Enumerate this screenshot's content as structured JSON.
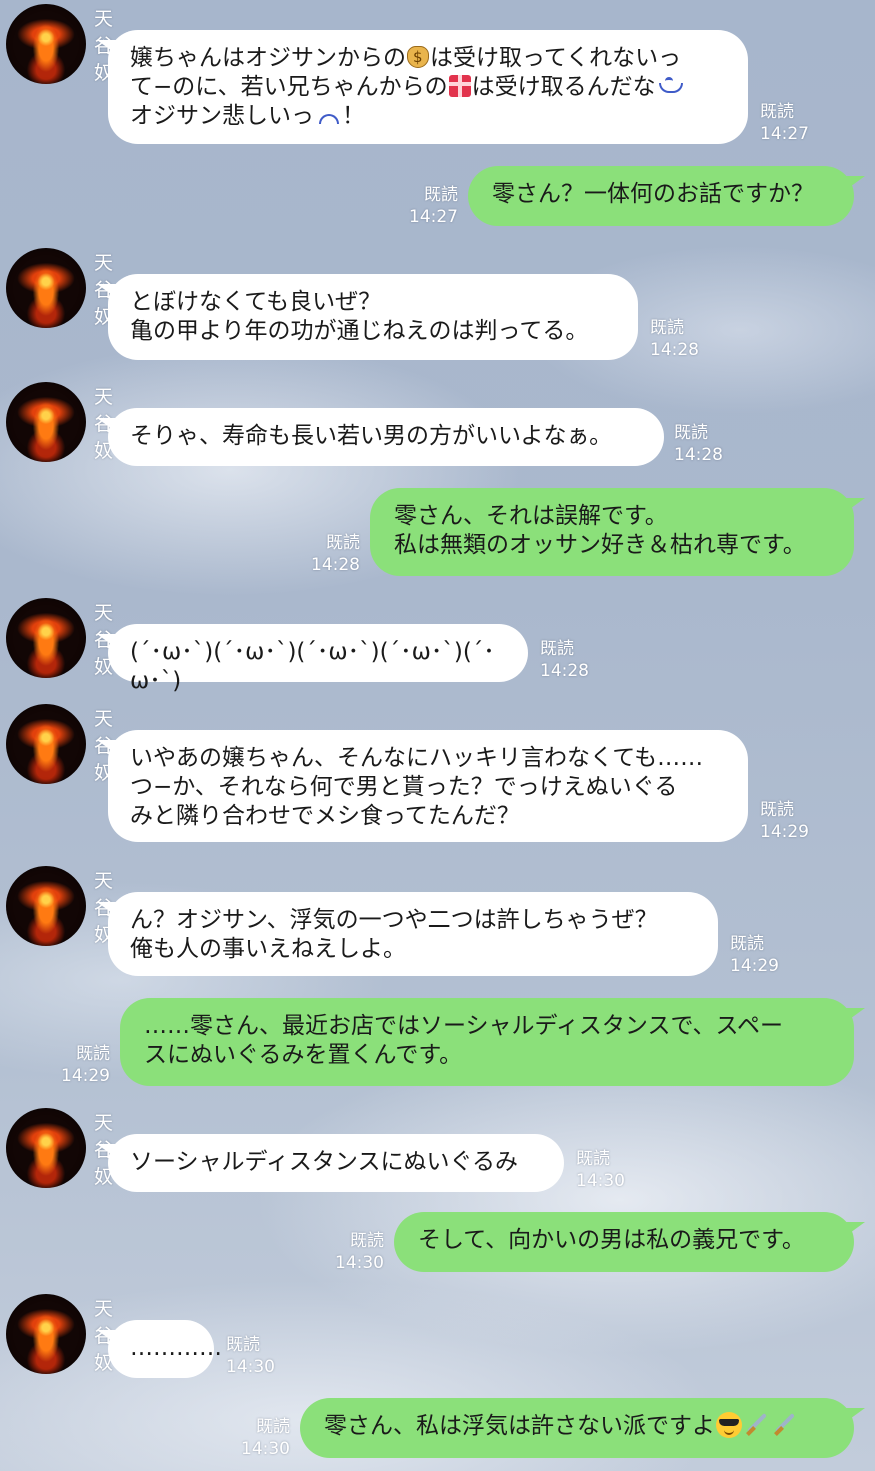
{
  "chat": {
    "sender_name": "天谷奴",
    "read_label": "既読",
    "messages": [
      {
        "side": "in",
        "text": "嬢ちゃんはオジサンからの{money}は受け取ってくれないっ\nて−のに、若い兄ちゃんからの{gift}は受け取るんだな{sweat}\nオジサン悲しいっ{sad}！",
        "time": "14:27"
      },
      {
        "side": "out",
        "text": "零さん？一体何のお話ですか？",
        "time": "14:27"
      },
      {
        "side": "in",
        "text": "とぼけなくても良いぜ？\n亀の甲より年の功が通じねえのは判ってる。",
        "time": "14:28"
      },
      {
        "side": "in",
        "text": "そりゃ、寿命も長い若い男の方がいいよなぁ。",
        "time": "14:28"
      },
      {
        "side": "out",
        "text": "零さん、それは誤解です。\n私は無類のオッサン好き＆枯れ専です。",
        "time": "14:28"
      },
      {
        "side": "in",
        "text": "(´･ω･`)(´･ω･`)(´･ω･`)(´･ω･`)(´･ω･`)",
        "time": "14:28"
      },
      {
        "side": "in",
        "text": "いやあの嬢ちゃん、そんなにハッキリ言わなくても……\nつ−か、それなら何で男と貰った？でっけえぬいぐる\nみと隣り合わせでメシ食ってたんだ？",
        "time": "14:29"
      },
      {
        "side": "in",
        "text": "ん？オジサン、浮気の一つや二つは許しちゃうぜ？\n俺も人の事いえねえしよ。",
        "time": "14:29"
      },
      {
        "side": "out",
        "text": "……零さん、最近お店ではソーシャルディスタンスで、スペー\nスにぬいぐるみを置くんです。",
        "time": "14:29"
      },
      {
        "side": "in",
        "text": "ソーシャルディスタンスにぬいぐるみ",
        "time": "14:30"
      },
      {
        "side": "out",
        "text": "そして、向かいの男は私の義兄です。",
        "time": "14:30"
      },
      {
        "side": "in",
        "text": "…………",
        "time": "14:30"
      },
      {
        "side": "out",
        "text": "零さん、私は浮気は許さない派ですよ{sunglasses}{dagger}{dagger}",
        "time": "14:30"
      }
    ]
  },
  "emoji": {
    "money": "money-bag-icon",
    "gift": "gift-icon",
    "sweat": "sweat-face-icon",
    "sad": "sad-face-icon",
    "sunglasses": "sunglasses-face-icon",
    "dagger": "dagger-icon"
  },
  "colors": {
    "incoming_bubble": "#ffffff",
    "outgoing_bubble": "#8be07a",
    "meta_text": "#ffffff"
  }
}
